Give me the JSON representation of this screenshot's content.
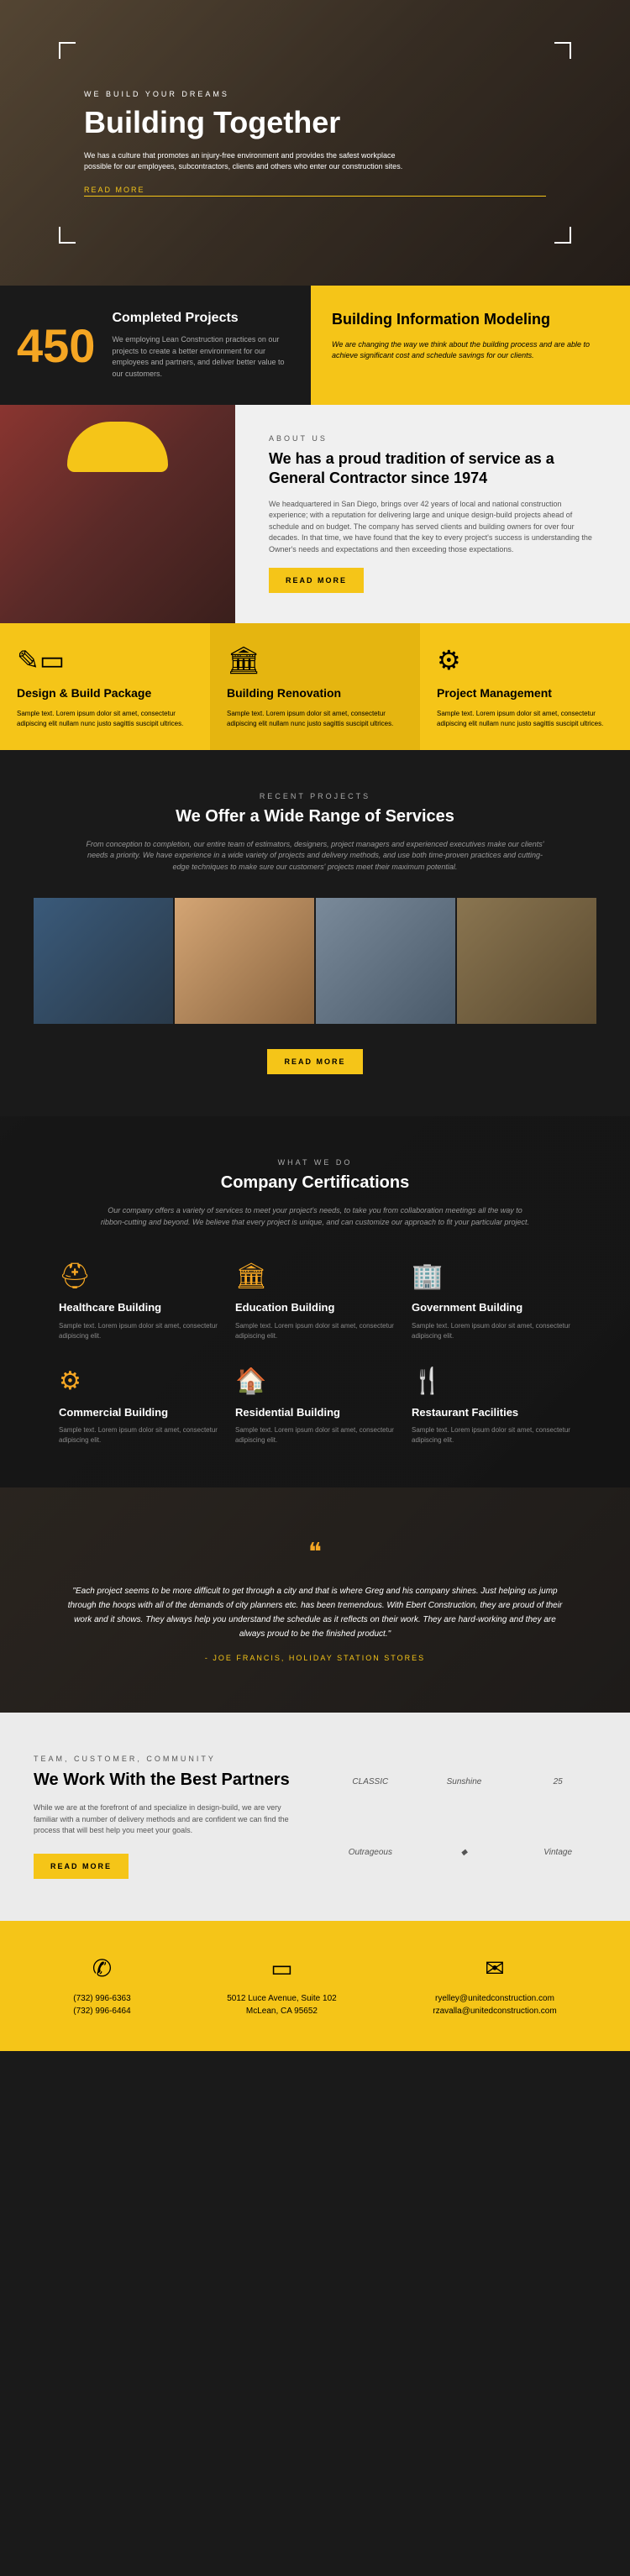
{
  "hero": {
    "eyebrow": "WE BUILD YOUR DREAMS",
    "title": "Building Together",
    "desc": "We has a culture that promotes an injury-free environment and provides the safest workplace possible for our employees, subcontractors, clients and others who enter our construction sites.",
    "btn": "READ MORE"
  },
  "stats": {
    "number": "450",
    "title": "Completed Projects",
    "desc": "We employing Lean Construction practices on our projects to create a better environment for our employees and partners, and deliver better value to our customers."
  },
  "info": {
    "title": "Building Information Modeling",
    "desc": "We are changing the way we think about the building process and are able to achieve significant cost and schedule savings for our clients."
  },
  "about": {
    "eyebrow": "ABOUT US",
    "title": "We has a proud tradition of service as a General Contractor since 1974",
    "desc": "We headquartered in San Diego, brings over 42 years of local and national construction experience; with a reputation for delivering large and unique design-build projects ahead of schedule and on budget. The company has served clients and building owners for over four decades. In that time, we have found that the key to every project's success is understanding the Owner's needs and expectations and then exceeding those expectations.",
    "btn": "READ MORE"
  },
  "services": [
    {
      "title": "Design & Build Package",
      "desc": "Sample text. Lorem ipsum dolor sit amet, consectetur adipiscing elit nullam nunc justo sagittis suscipit ultrices."
    },
    {
      "title": "Building Renovation",
      "desc": "Sample text. Lorem ipsum dolor sit amet, consectetur adipiscing elit nullam nunc justo sagittis suscipit ultrices."
    },
    {
      "title": "Project Management",
      "desc": "Sample text. Lorem ipsum dolor sit amet, consectetur adipiscing elit nullam nunc justo sagittis suscipit ultrices."
    }
  ],
  "projects": {
    "eyebrow": "RECENT PROJECTS",
    "title": "We Offer a Wide Range of Services",
    "desc": "From conception to completion, our entire team of estimators, designers, project managers and experienced executives make our clients' needs a priority. We have experience in a wide variety of projects and delivery methods, and use both time-proven practices and cutting-edge techniques to make sure our customers' projects meet their maximum potential.",
    "btn": "READ MORE"
  },
  "certs": {
    "eyebrow": "WHAT WE DO",
    "title": "Company Certifications",
    "desc": "Our company offers a variety of services to meet your project's needs, to take you from collaboration meetings all the way to ribbon-cutting and beyond. We believe that every project is unique, and can customize our approach to fit your particular project.",
    "items": [
      {
        "title": "Healthcare Building",
        "desc": "Sample text. Lorem ipsum dolor sit amet, consectetur adipiscing elit."
      },
      {
        "title": "Education Building",
        "desc": "Sample text. Lorem ipsum dolor sit amet, consectetur adipiscing elit."
      },
      {
        "title": "Government Building",
        "desc": "Sample text. Lorem ipsum dolor sit amet, consectetur adipiscing elit."
      },
      {
        "title": "Commercial Building",
        "desc": "Sample text. Lorem ipsum dolor sit amet, consectetur adipiscing elit."
      },
      {
        "title": "Residential Building",
        "desc": "Sample text. Lorem ipsum dolor sit amet, consectetur adipiscing elit."
      },
      {
        "title": "Restaurant Facilities",
        "desc": "Sample text. Lorem ipsum dolor sit amet, consectetur adipiscing elit."
      }
    ]
  },
  "testimonial": {
    "quote": "\"Each project seems to be more difficult to get through a city and that is where Greg and his company shines. Just helping us jump through the hoops with all of the demands of city planners etc. has been tremendous. With Ebert Construction, they are proud of their work and it shows. They always help you understand the schedule as it reflects on their work. They are hard-working and they are always proud to be the finished product.\"",
    "author": "- JOE FRANCIS, HOLIDAY STATION STORES"
  },
  "partners": {
    "eyebrow": "TEAM, CUSTOMER, COMMUNITY",
    "title": "We Work With the Best Partners",
    "desc": "While we are at the forefront of and specialize in design-build, we are very familiar with a number of delivery methods and are confident we can find the process that will best help you meet your goals.",
    "btn": "READ MORE",
    "logos": [
      "CLASSIC",
      "Sunshine",
      "25",
      "Outrageous",
      "◆",
      "Vintage"
    ]
  },
  "contact": {
    "phone1": "(732) 996-6363",
    "phone2": "(732) 996-6464",
    "addr1": "5012 Luce Avenue, Suite 102",
    "addr2": "McLean, CA 95652",
    "email1": "ryelley@unitedconstruction.com",
    "email2": "rzavalla@unitedconstruction.com"
  }
}
